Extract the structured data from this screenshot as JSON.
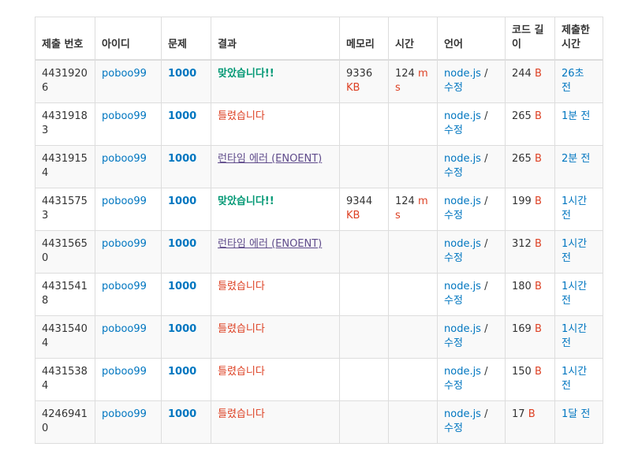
{
  "headers": {
    "submission_id": "제출 번호",
    "user": "아이디",
    "problem": "문제",
    "result": "결과",
    "memory": "메모리",
    "time": "시간",
    "language": "언어",
    "code_length": "코드 길이",
    "submitted": "제출한 시간"
  },
  "rows": [
    {
      "id": "44319206",
      "user": "poboo99",
      "problem": "1000",
      "result": "맞았습니다!!",
      "memory": "9336",
      "memory_unit": "KB",
      "time": "124",
      "time_unit": "ms",
      "lang": "node.js",
      "lang_sep": "/",
      "edit": "수정",
      "length": "244",
      "length_unit": "B",
      "when": "26초 전"
    },
    {
      "id": "44319183",
      "user": "poboo99",
      "problem": "1000",
      "result": "틀렸습니다",
      "memory": "",
      "memory_unit": "",
      "time": "",
      "time_unit": "",
      "lang": "node.js",
      "lang_sep": "/",
      "edit": "수정",
      "length": "265",
      "length_unit": "B",
      "when": "1분 전"
    },
    {
      "id": "44319154",
      "user": "poboo99",
      "problem": "1000",
      "result": "런타임 에러 (ENOENT)",
      "memory": "",
      "memory_unit": "",
      "time": "",
      "time_unit": "",
      "lang": "node.js",
      "lang_sep": "/",
      "edit": "수정",
      "length": "265",
      "length_unit": "B",
      "when": "2분 전"
    },
    {
      "id": "44315753",
      "user": "poboo99",
      "problem": "1000",
      "result": "맞았습니다!!",
      "memory": "9344",
      "memory_unit": "KB",
      "time": "124",
      "time_unit": "ms",
      "lang": "node.js",
      "lang_sep": "/",
      "edit": "수정",
      "length": "199",
      "length_unit": "B",
      "when": "1시간 전"
    },
    {
      "id": "44315650",
      "user": "poboo99",
      "problem": "1000",
      "result": "런타임 에러 (ENOENT)",
      "memory": "",
      "memory_unit": "",
      "time": "",
      "time_unit": "",
      "lang": "node.js",
      "lang_sep": "/",
      "edit": "수정",
      "length": "312",
      "length_unit": "B",
      "when": "1시간 전"
    },
    {
      "id": "44315418",
      "user": "poboo99",
      "problem": "1000",
      "result": "틀렸습니다",
      "memory": "",
      "memory_unit": "",
      "time": "",
      "time_unit": "",
      "lang": "node.js",
      "lang_sep": "/",
      "edit": "수정",
      "length": "180",
      "length_unit": "B",
      "when": "1시간 전"
    },
    {
      "id": "44315404",
      "user": "poboo99",
      "problem": "1000",
      "result": "틀렸습니다",
      "memory": "",
      "memory_unit": "",
      "time": "",
      "time_unit": "",
      "lang": "node.js",
      "lang_sep": "/",
      "edit": "수정",
      "length": "169",
      "length_unit": "B",
      "when": "1시간 전"
    },
    {
      "id": "44315384",
      "user": "poboo99",
      "problem": "1000",
      "result": "틀렸습니다",
      "memory": "",
      "memory_unit": "",
      "time": "",
      "time_unit": "",
      "lang": "node.js",
      "lang_sep": "/",
      "edit": "수정",
      "length": "150",
      "length_unit": "B",
      "when": "1시간 전"
    },
    {
      "id": "42469410",
      "user": "poboo99",
      "problem": "1000",
      "result": "틀렸습니다",
      "memory": "",
      "memory_unit": "",
      "time": "",
      "time_unit": "",
      "lang": "node.js",
      "lang_sep": "/",
      "edit": "수정",
      "length": "17",
      "length_unit": "B",
      "when": "1달 전"
    }
  ],
  "colors": {
    "link": "#0076c0",
    "accepted": "#009874",
    "wrong": "#dd4124",
    "runtime_error": "#5f4b8b",
    "unit": "#dd4124"
  }
}
